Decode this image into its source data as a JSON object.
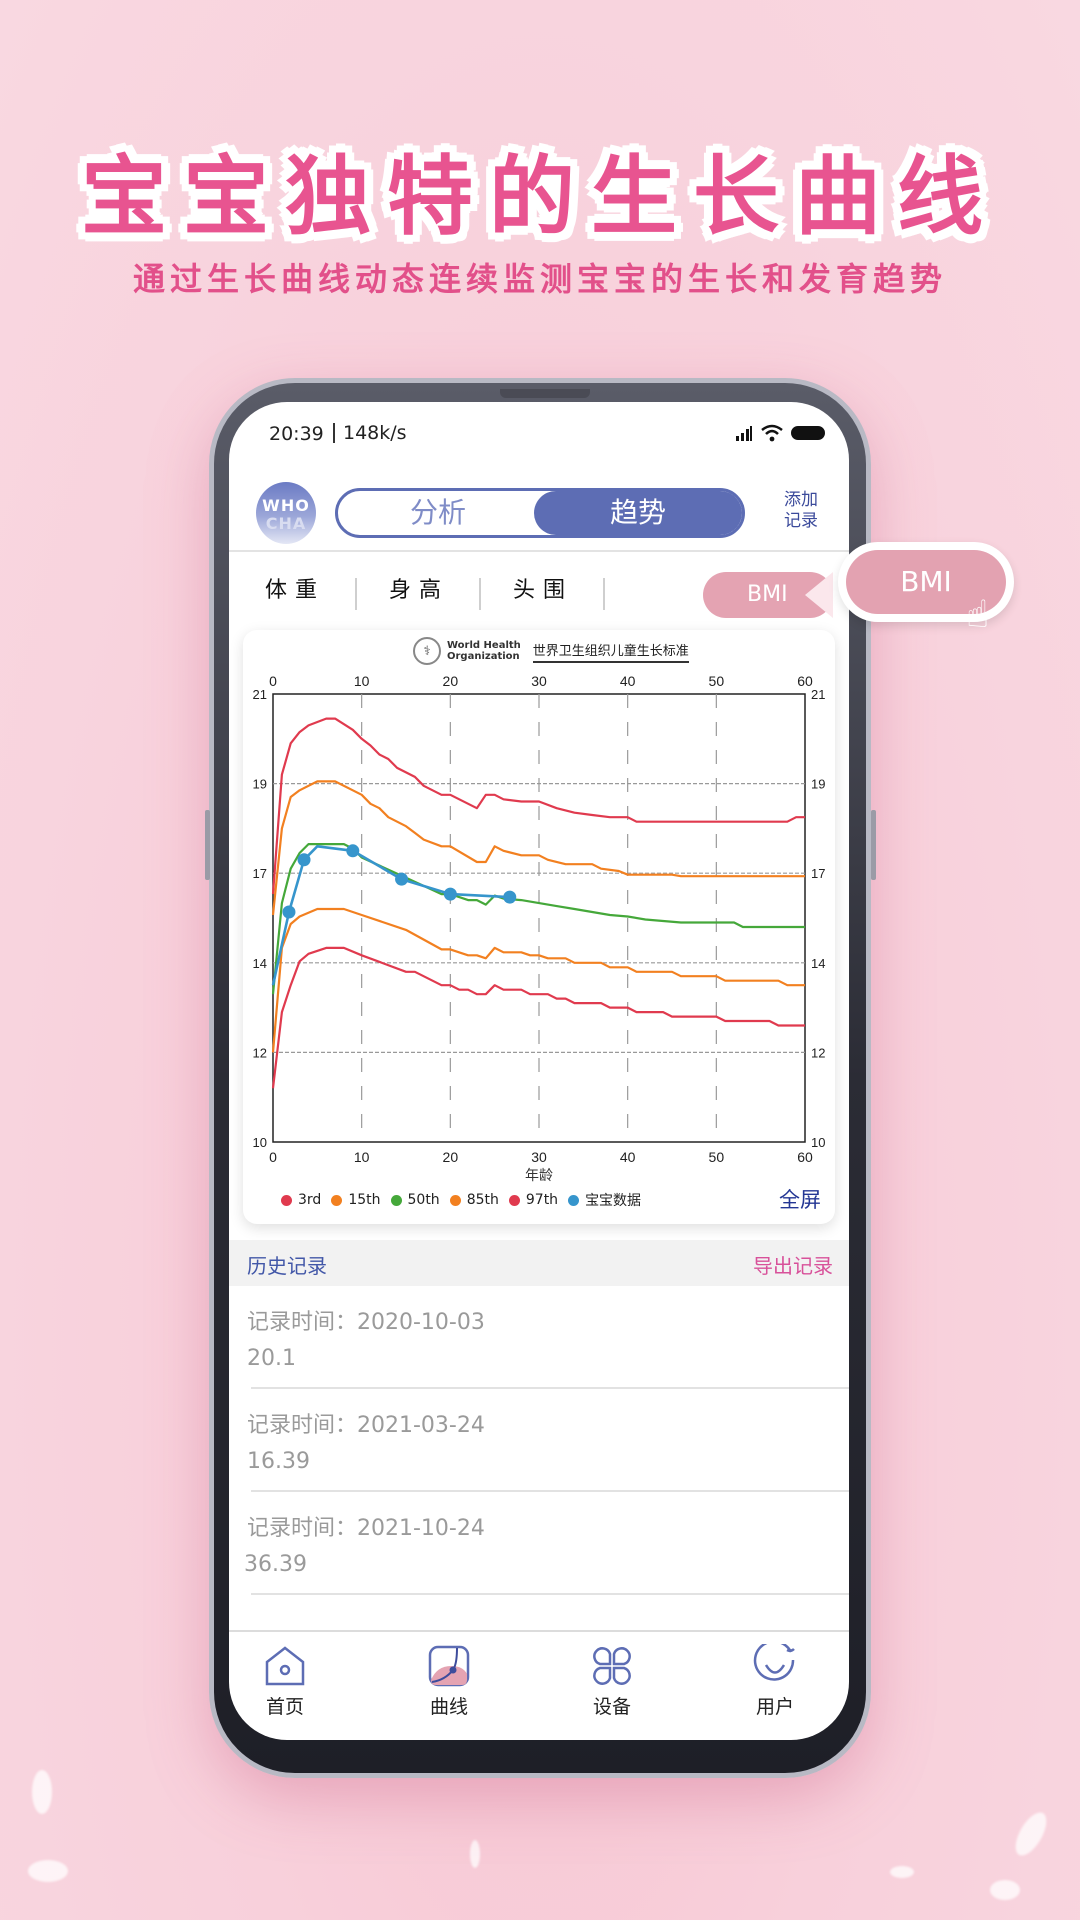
{
  "promo": {
    "headline": "宝宝独特的生长曲线",
    "subline": "通过生长曲线动态连续监测宝宝的生长和发育趋势"
  },
  "status_bar": {
    "time": "20:39",
    "speed": "148k/s",
    "icons": [
      "signal-icon",
      "wifi-icon",
      "battery-icon"
    ]
  },
  "header": {
    "logo_line1": "WHO",
    "logo_line2": "CHA",
    "segments": [
      {
        "label": "分析",
        "active": false
      },
      {
        "label": "趋势",
        "active": true
      }
    ],
    "add_record": "添加记录"
  },
  "metric_tabs": [
    {
      "label": "体重",
      "active": false
    },
    {
      "label": "身高",
      "active": false
    },
    {
      "label": "头围",
      "active": false
    },
    {
      "label": "BMI",
      "active": true
    }
  ],
  "callout": {
    "label": "BMI",
    "icon": "hand-pointer-icon"
  },
  "chart_card": {
    "org_name_line1": "World Health",
    "org_name_line2": "Organization",
    "standard_title": "世界卫生组织儿童生长标准",
    "fullscreen": "全屏"
  },
  "chart_data": {
    "type": "line",
    "title": "世界卫生组织儿童生长标准",
    "xlabel": "年龄",
    "ylabel": "",
    "xlim": [
      0,
      60
    ],
    "x_ticks": [
      0,
      10,
      20,
      30,
      40,
      50,
      60
    ],
    "y_ticks": [
      10,
      12,
      14,
      17,
      19,
      21
    ],
    "ylim": [
      10,
      21
    ],
    "grid": true,
    "legend_position": "bottom",
    "colors": {
      "3rd": "#e03a4e",
      "15th": "#f28020",
      "50th": "#45a83a",
      "85th": "#f28020",
      "97th": "#e03a4e",
      "宝宝数据": "#3695cc"
    },
    "series": [
      {
        "name": "97th",
        "points": [
          [
            0,
            16.3
          ],
          [
            1,
            19.2
          ],
          [
            2,
            19.9
          ],
          [
            3,
            20.15
          ],
          [
            4,
            20.3
          ],
          [
            6,
            20.45
          ],
          [
            7,
            20.45
          ],
          [
            9,
            20.2
          ],
          [
            10,
            20.0
          ],
          [
            11,
            19.85
          ],
          [
            12,
            19.65
          ],
          [
            13,
            19.55
          ],
          [
            14,
            19.35
          ],
          [
            16,
            19.15
          ],
          [
            17,
            18.95
          ],
          [
            19,
            18.75
          ],
          [
            20,
            18.75
          ],
          [
            23,
            18.45
          ],
          [
            24,
            18.75
          ],
          [
            25,
            18.75
          ],
          [
            26,
            18.65
          ],
          [
            28,
            18.6
          ],
          [
            30,
            18.6
          ],
          [
            32,
            18.45
          ],
          [
            34,
            18.35
          ],
          [
            36,
            18.3
          ],
          [
            38,
            18.25
          ],
          [
            40,
            18.25
          ],
          [
            41,
            18.15
          ],
          [
            58,
            18.15
          ],
          [
            59,
            18.25
          ],
          [
            60,
            18.25
          ]
        ]
      },
      {
        "name": "85th",
        "points": [
          [
            0,
            15.6
          ],
          [
            1,
            18.0
          ],
          [
            2,
            18.7
          ],
          [
            3,
            18.85
          ],
          [
            5,
            19.05
          ],
          [
            7,
            19.05
          ],
          [
            9,
            18.85
          ],
          [
            10,
            18.75
          ],
          [
            11,
            18.55
          ],
          [
            12,
            18.45
          ],
          [
            13,
            18.25
          ],
          [
            15,
            18.05
          ],
          [
            16,
            17.9
          ],
          [
            17,
            17.75
          ],
          [
            19,
            17.6
          ],
          [
            20,
            17.6
          ],
          [
            23,
            17.25
          ],
          [
            24,
            17.25
          ],
          [
            25,
            17.6
          ],
          [
            26,
            17.5
          ],
          [
            28,
            17.4
          ],
          [
            30,
            17.4
          ],
          [
            31,
            17.3
          ],
          [
            33,
            17.2
          ],
          [
            36,
            17.2
          ],
          [
            37,
            17.1
          ],
          [
            39,
            17.05
          ],
          [
            40,
            16.95
          ],
          [
            45,
            16.95
          ],
          [
            46,
            16.9
          ],
          [
            60,
            16.9
          ]
        ]
      },
      {
        "name": "50th",
        "points": [
          [
            0,
            13.3
          ],
          [
            1,
            16.0
          ],
          [
            2,
            17.1
          ],
          [
            3,
            17.45
          ],
          [
            4,
            17.65
          ],
          [
            5,
            17.65
          ],
          [
            8,
            17.65
          ],
          [
            9,
            17.55
          ],
          [
            10,
            17.35
          ],
          [
            15,
            16.85
          ],
          [
            19,
            16.3
          ],
          [
            20,
            16.3
          ],
          [
            22,
            16.1
          ],
          [
            23,
            16.1
          ],
          [
            24,
            15.95
          ],
          [
            25,
            16.25
          ],
          [
            26,
            16.15
          ],
          [
            28,
            16.1
          ],
          [
            30,
            16.0
          ],
          [
            32,
            15.9
          ],
          [
            34,
            15.8
          ],
          [
            36,
            15.7
          ],
          [
            38,
            15.6
          ],
          [
            40,
            15.55
          ],
          [
            42,
            15.45
          ],
          [
            46,
            15.35
          ],
          [
            52,
            15.35
          ],
          [
            53,
            15.2
          ],
          [
            60,
            15.2
          ]
        ]
      },
      {
        "name": "15th",
        "points": [
          [
            0,
            12.0
          ],
          [
            1,
            14.5
          ],
          [
            2,
            15.3
          ],
          [
            3,
            15.55
          ],
          [
            5,
            15.8
          ],
          [
            8,
            15.8
          ],
          [
            10,
            15.6
          ],
          [
            15,
            15.1
          ],
          [
            19,
            14.45
          ],
          [
            20,
            14.45
          ],
          [
            22,
            14.25
          ],
          [
            23,
            14.25
          ],
          [
            24,
            14.15
          ],
          [
            25,
            14.5
          ],
          [
            26,
            14.35
          ],
          [
            28,
            14.35
          ],
          [
            29,
            14.25
          ],
          [
            30,
            14.25
          ],
          [
            31,
            14.15
          ],
          [
            33,
            14.15
          ],
          [
            34,
            14.0
          ],
          [
            37,
            14.0
          ],
          [
            38,
            13.9
          ],
          [
            40,
            13.9
          ],
          [
            41,
            13.8
          ],
          [
            45,
            13.8
          ],
          [
            46,
            13.7
          ],
          [
            50,
            13.7
          ],
          [
            51,
            13.6
          ],
          [
            57,
            13.6
          ],
          [
            58,
            13.5
          ],
          [
            60,
            13.5
          ]
        ]
      },
      {
        "name": "3rd",
        "points": [
          [
            0,
            11.2
          ],
          [
            1,
            12.9
          ],
          [
            2,
            13.5
          ],
          [
            3,
            14.05
          ],
          [
            4,
            14.3
          ],
          [
            6,
            14.5
          ],
          [
            8,
            14.5
          ],
          [
            10,
            14.25
          ],
          [
            15,
            13.8
          ],
          [
            16,
            13.8
          ],
          [
            19,
            13.5
          ],
          [
            20,
            13.5
          ],
          [
            21,
            13.4
          ],
          [
            22,
            13.4
          ],
          [
            23,
            13.3
          ],
          [
            24,
            13.3
          ],
          [
            25,
            13.5
          ],
          [
            26,
            13.4
          ],
          [
            28,
            13.4
          ],
          [
            29,
            13.3
          ],
          [
            31,
            13.3
          ],
          [
            32,
            13.2
          ],
          [
            33,
            13.2
          ],
          [
            34,
            13.1
          ],
          [
            37,
            13.1
          ],
          [
            38,
            13.0
          ],
          [
            40,
            13.0
          ],
          [
            41,
            12.9
          ],
          [
            44,
            12.9
          ],
          [
            45,
            12.8
          ],
          [
            50,
            12.8
          ],
          [
            51,
            12.7
          ],
          [
            56,
            12.7
          ],
          [
            57,
            12.6
          ],
          [
            60,
            12.6
          ]
        ]
      },
      {
        "name": "宝宝数据",
        "markers": true,
        "points": [
          [
            0,
            13.5
          ],
          [
            1.8,
            15.7
          ],
          [
            3.5,
            17.3
          ],
          [
            5,
            17.6
          ],
          [
            9,
            17.5
          ],
          [
            14.5,
            16.8
          ],
          [
            20,
            16.3
          ],
          [
            26.7,
            16.2
          ]
        ],
        "marker_points": [
          [
            1.8,
            15.7
          ],
          [
            3.5,
            17.3
          ],
          [
            9,
            17.5
          ],
          [
            14.5,
            16.8
          ],
          [
            20,
            16.3
          ],
          [
            26.7,
            16.2
          ]
        ]
      }
    ],
    "legend": [
      "3rd",
      "15th",
      "50th",
      "85th",
      "97th",
      "宝宝数据"
    ]
  },
  "history": {
    "title": "历史记录",
    "export": "导出记录",
    "records": [
      {
        "time_label": "记录时间：2020-10-03",
        "value": "20.1"
      },
      {
        "time_label": "记录时间：2021-03-24",
        "value": "16.39"
      },
      {
        "time_label": "记录时间：2021-10-24",
        "value": "36.39"
      }
    ]
  },
  "bottom_nav": [
    {
      "label": "首页",
      "icon": "home-icon"
    },
    {
      "label": "曲线",
      "icon": "curve-icon",
      "active": true
    },
    {
      "label": "设备",
      "icon": "device-grid-icon"
    },
    {
      "label": "用户",
      "icon": "user-smile-icon"
    }
  ]
}
